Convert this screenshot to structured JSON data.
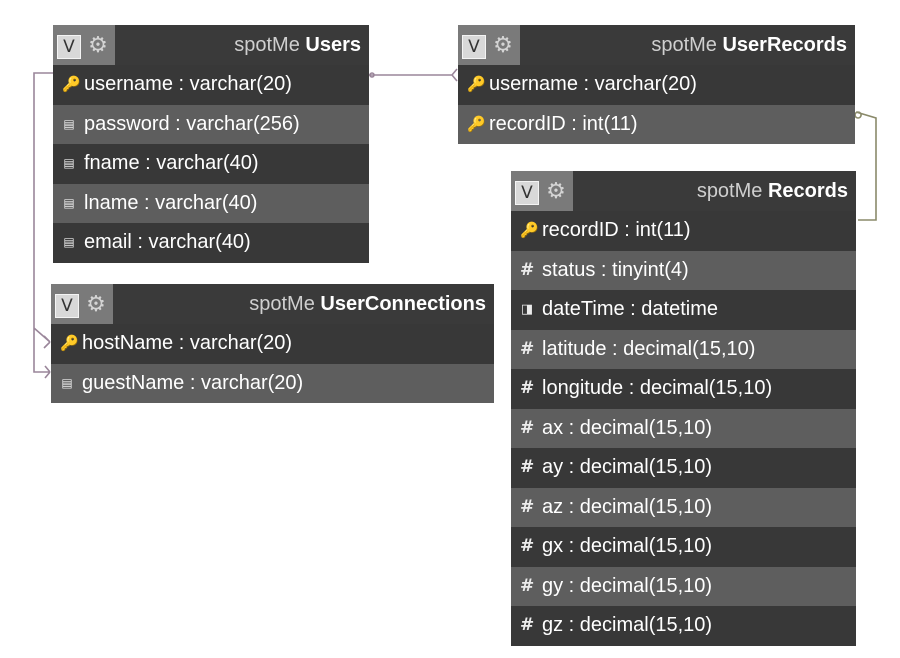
{
  "tables": {
    "users": {
      "prefix": "spotMe",
      "name": "Users",
      "fields": [
        {
          "icon": "key-icon",
          "text": "username : varchar(20)"
        },
        {
          "icon": "column-icon",
          "text": "password : varchar(256)"
        },
        {
          "icon": "column-icon",
          "text": "fname : varchar(40)"
        },
        {
          "icon": "column-icon",
          "text": "lname : varchar(40)"
        },
        {
          "icon": "column-icon",
          "text": "email : varchar(40)"
        }
      ]
    },
    "userrecords": {
      "prefix": "spotMe",
      "name": "UserRecords",
      "fields": [
        {
          "icon": "key-icon",
          "text": "username : varchar(20)"
        },
        {
          "icon": "key-icon",
          "text": "recordID : int(11)"
        }
      ]
    },
    "userconnections": {
      "prefix": "spotMe",
      "name": "UserConnections",
      "fields": [
        {
          "icon": "key-icon",
          "text": "hostName : varchar(20)"
        },
        {
          "icon": "column-icon",
          "text": "guestName : varchar(20)"
        }
      ]
    },
    "records": {
      "prefix": "spotMe",
      "name": "Records",
      "fields": [
        {
          "icon": "key-icon",
          "text": "recordID : int(11)"
        },
        {
          "icon": "hash-icon",
          "text": "status : tinyint(4)"
        },
        {
          "icon": "date-icon",
          "text": "dateTime : datetime"
        },
        {
          "icon": "hash-icon",
          "text": "latitude : decimal(15,10)"
        },
        {
          "icon": "hash-icon",
          "text": "longitude : decimal(15,10)"
        },
        {
          "icon": "hash-icon",
          "text": "ax : decimal(15,10)"
        },
        {
          "icon": "hash-icon",
          "text": "ay : decimal(15,10)"
        },
        {
          "icon": "hash-icon",
          "text": "az : decimal(15,10)"
        },
        {
          "icon": "hash-icon",
          "text": "gx : decimal(15,10)"
        },
        {
          "icon": "hash-icon",
          "text": "gy : decimal(15,10)"
        },
        {
          "icon": "hash-icon",
          "text": "gz : decimal(15,10)"
        }
      ]
    }
  },
  "header_controls": {
    "collapse_symbol": "V",
    "options_icon": "gear-icon"
  },
  "colors": {
    "header": "#3a3a3a",
    "row_light": "#5e5e5e",
    "row_dark": "#383838",
    "control_strip": "#7a7a7a",
    "relation_line": "#9a869a",
    "relation_line_alt": "#8a8a6a"
  }
}
